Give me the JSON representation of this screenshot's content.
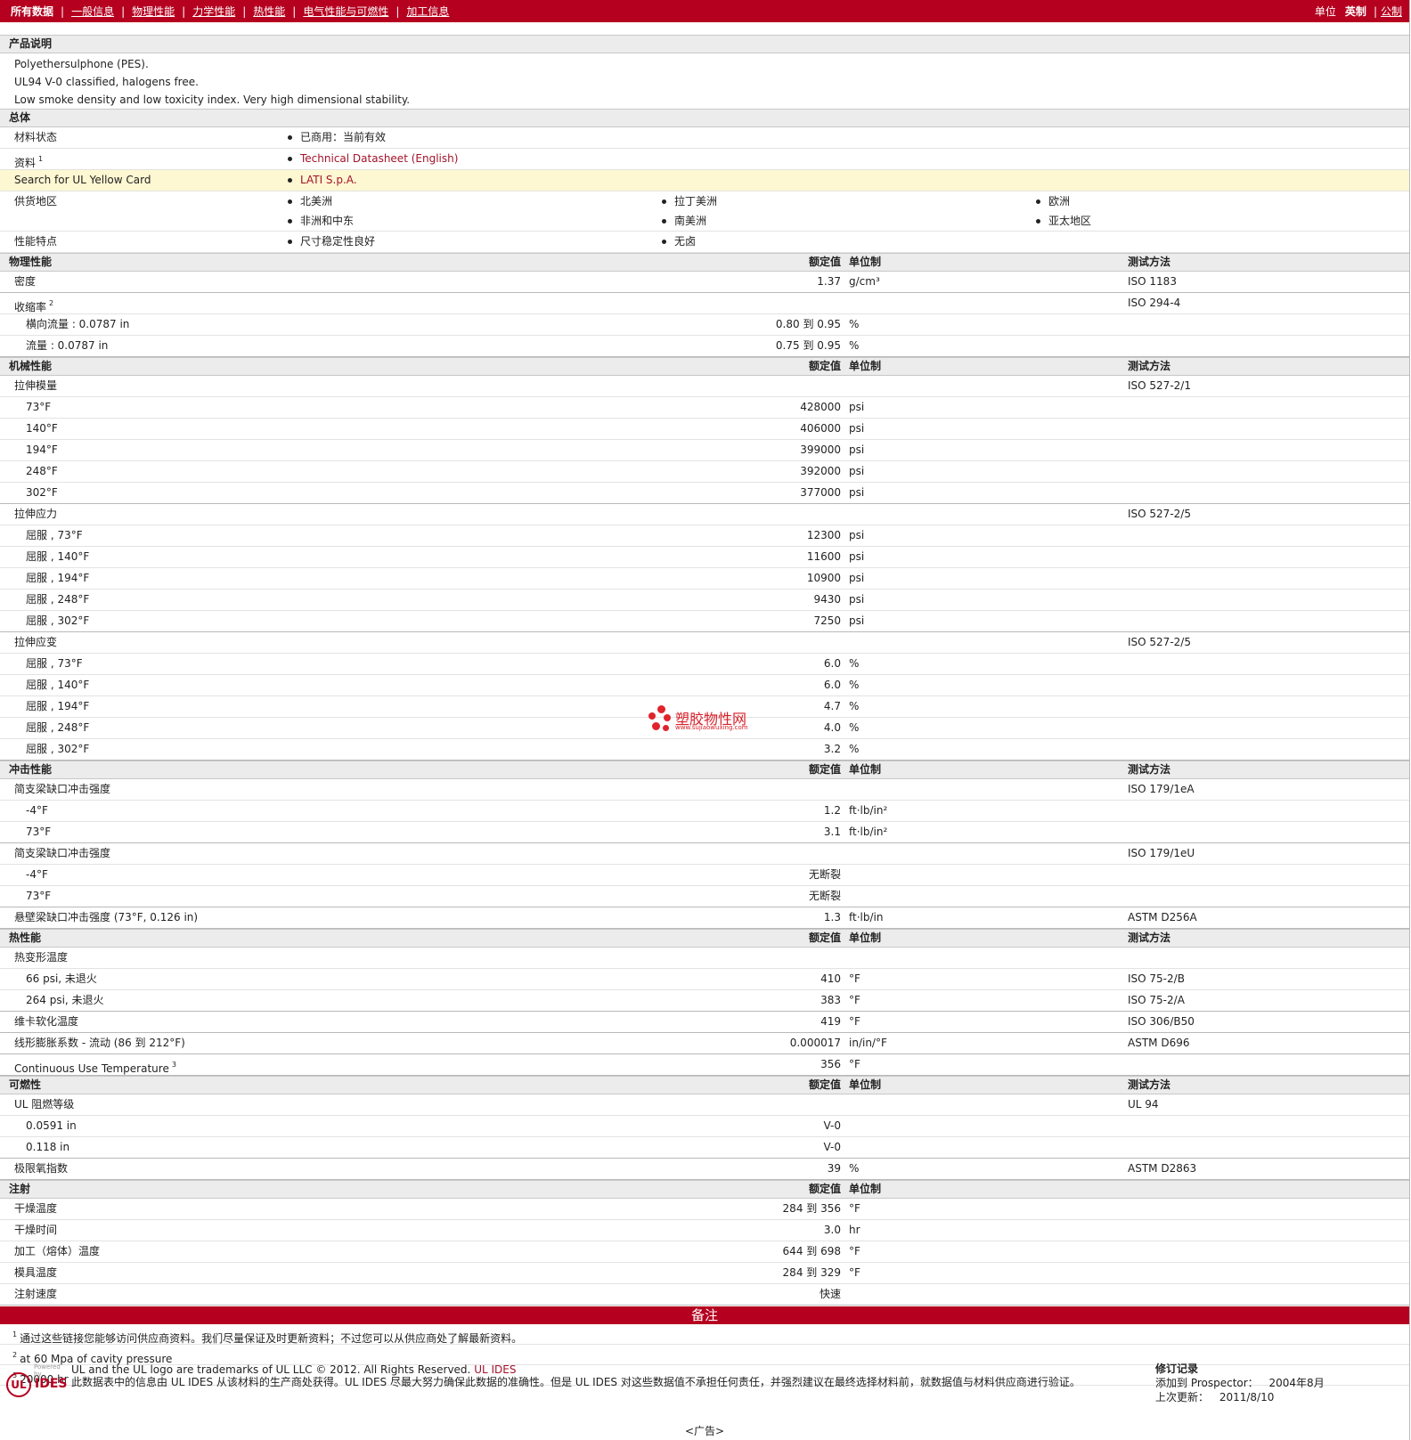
{
  "nav": {
    "items": [
      "所有数据",
      "一般信息",
      "物理性能",
      "力学性能",
      "热性能",
      "电气性能与可燃性",
      "加工信息"
    ],
    "units_label": "单位",
    "unit_english": "英制",
    "unit_metric": "公制",
    "separator": "|"
  },
  "description": {
    "title": "产品说明",
    "lines": [
      "Polyethersulphone (PES).",
      "UL94 V-0 classified, halogens free.",
      "Low smoke density and low toxicity index. Very high dimensional stability."
    ]
  },
  "general": {
    "title": "总体",
    "status_label": "材料状态",
    "status_value": "已商用：当前有效",
    "docs_label": "资料",
    "docs_sup": "1",
    "docs_link": "Technical Datasheet (English)",
    "yellow_card_label": "Search for UL Yellow Card",
    "supplier_link": "LATI S.p.A.",
    "regions_label": "供货地区",
    "regions": [
      "北美洲",
      "拉丁美洲",
      "欧洲",
      "非洲和中东",
      "南美洲",
      "亚太地区"
    ],
    "features_label": "性能特点",
    "features": [
      "尺寸稳定性良好",
      "无卤"
    ]
  },
  "headers": {
    "value": "额定值",
    "unit": "单位制",
    "test": "测试方法"
  },
  "sections": {
    "physical": "物理性能",
    "mechanical": "机械性能",
    "impact": "冲击性能",
    "thermal": "热性能",
    "flammability": "可燃性",
    "injection": "注射"
  },
  "physical": [
    {
      "prop": "密度",
      "value": "1.37",
      "unit": "g/cm³",
      "test": "ISO 1183"
    },
    {
      "prop": "收缩率",
      "sup": "2",
      "test": "ISO 294-4"
    },
    {
      "prop": "横向流量 : 0.0787 in",
      "value": "0.80 到  0.95",
      "unit": "%"
    },
    {
      "prop": "流量 : 0.0787 in",
      "value": "0.75 到  0.95",
      "unit": "%"
    }
  ],
  "mechanical": [
    {
      "prop": "拉伸模量",
      "test": "ISO 527-2/1"
    },
    {
      "prop": "73°F",
      "value": "428000",
      "unit": "psi"
    },
    {
      "prop": "140°F",
      "value": "406000",
      "unit": "psi"
    },
    {
      "prop": "194°F",
      "value": "399000",
      "unit": "psi"
    },
    {
      "prop": "248°F",
      "value": "392000",
      "unit": "psi"
    },
    {
      "prop": "302°F",
      "value": "377000",
      "unit": "psi"
    },
    {
      "prop": "拉伸应力",
      "test": "ISO 527-2/5"
    },
    {
      "prop": "屈服 , 73°F",
      "value": "12300",
      "unit": "psi"
    },
    {
      "prop": "屈服 , 140°F",
      "value": "11600",
      "unit": "psi"
    },
    {
      "prop": "屈服 , 194°F",
      "value": "10900",
      "unit": "psi"
    },
    {
      "prop": "屈服 , 248°F",
      "value": "9430",
      "unit": "psi"
    },
    {
      "prop": "屈服 , 302°F",
      "value": "7250",
      "unit": "psi"
    },
    {
      "prop": "拉伸应变",
      "test": "ISO 527-2/5"
    },
    {
      "prop": "屈服 , 73°F",
      "value": "6.0",
      "unit": "%"
    },
    {
      "prop": "屈服 , 140°F",
      "value": "6.0",
      "unit": "%"
    },
    {
      "prop": "屈服 , 194°F",
      "value": "4.7",
      "unit": "%"
    },
    {
      "prop": "屈服 , 248°F",
      "value": "4.0",
      "unit": "%"
    },
    {
      "prop": "屈服 , 302°F",
      "value": "3.2",
      "unit": "%"
    }
  ],
  "impact": [
    {
      "prop": "简支梁缺口冲击强度",
      "test": "ISO 179/1eA"
    },
    {
      "prop": "-4°F",
      "value": "1.2",
      "unit": "ft·lb/in²"
    },
    {
      "prop": "73°F",
      "value": "3.1",
      "unit": "ft·lb/in²"
    },
    {
      "prop": "简支梁缺口冲击强度",
      "test": "ISO 179/1eU"
    },
    {
      "prop": "-4°F",
      "value": "无断裂"
    },
    {
      "prop": "73°F",
      "value": "无断裂"
    },
    {
      "prop": "悬壁梁缺口冲击强度 (73°F, 0.126 in)",
      "value": "1.3",
      "unit": "ft·lb/in",
      "test": "ASTM D256A"
    }
  ],
  "thermal": [
    {
      "prop": "热变形温度"
    },
    {
      "prop": "66 psi, 未退火",
      "value": "410",
      "unit": "°F",
      "test": "ISO 75-2/B"
    },
    {
      "prop": "264 psi, 未退火",
      "value": "383",
      "unit": "°F",
      "test": "ISO 75-2/A"
    },
    {
      "prop": "维卡软化温度",
      "value": "419",
      "unit": "°F",
      "test": "ISO 306/B50"
    },
    {
      "prop": "线形膨胀系数  - 流动  (86 到  212°F)",
      "value": "0.000017",
      "unit": "in/in/°F",
      "test": "ASTM D696"
    },
    {
      "prop": "Continuous Use Temperature",
      "sup": "3",
      "value": "356",
      "unit": "°F"
    }
  ],
  "flammability": [
    {
      "prop": "UL 阻燃等级",
      "test": "UL 94"
    },
    {
      "prop": "0.0591 in",
      "value": "V-0"
    },
    {
      "prop": "0.118 in",
      "value": "V-0"
    },
    {
      "prop": "极限氧指数",
      "value": "39",
      "unit": "%",
      "test": "ASTM D2863"
    }
  ],
  "injection": [
    {
      "prop": "干燥温度",
      "value": "284 到  356",
      "unit": "°F"
    },
    {
      "prop": "干燥时间",
      "value": "3.0",
      "unit": "hr"
    },
    {
      "prop": "加工（熔体）温度",
      "value": "644 到  698",
      "unit": "°F"
    },
    {
      "prop": "模具温度",
      "value": "284 到  329",
      "unit": "°F"
    },
    {
      "prop": "注射速度",
      "value": "快速"
    }
  ],
  "notes": {
    "title": "备注",
    "items": [
      {
        "n": "1",
        "text": "通过这些链接您能够访问供应商资料。我们尽量保证及时更新资料；不过您可以从供应商处了解最新资料。"
      },
      {
        "n": "2",
        "text": "at 60 Mpa of cavity pressure"
      },
      {
        "n": "3",
        "text": "20000 hr"
      }
    ]
  },
  "footer": {
    "powered": "Powered by",
    "logo_ul": "UL",
    "logo_ides": "IDES",
    "trademark": "UL and the UL logo are trademarks of UL LLC © 2012. All Rights Reserved.",
    "trademark_link": "UL IDES",
    "disclaimer": "此数据表中的信息由  UL IDES 从该材料的生产商处获得。UL IDES 尽最大努力确保此数据的准确性。但是  UL IDES 对这些数据值不承担任何责任，并强烈建议在最终选择材料前，就数据值与材料供应商进行验证。",
    "rev_title": "修订记录",
    "added_label": "添加到  Prospector：",
    "added_value": "2004年8月",
    "updated_label": "上次更新：",
    "updated_value": "2011/8/10",
    "ad": "<广告>"
  },
  "watermark": {
    "text": "塑胶物性网",
    "url": "www.sujiaowuxing.com"
  },
  "colors": {
    "brand": "#b5001f",
    "link": "#a3122a",
    "highlight": "#fdf7d2",
    "section_bg": "#ececec"
  }
}
